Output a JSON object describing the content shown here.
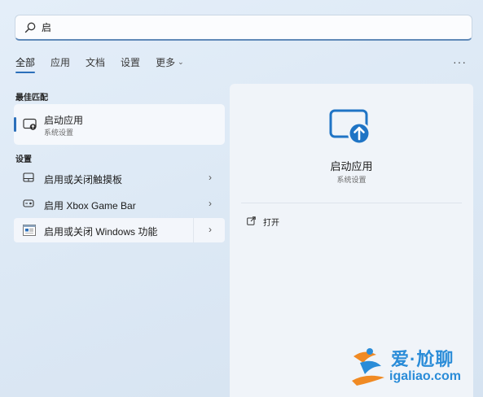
{
  "search": {
    "query": "启",
    "icon": "search-icon"
  },
  "tabs": [
    {
      "label": "全部",
      "active": true
    },
    {
      "label": "应用"
    },
    {
      "label": "文档"
    },
    {
      "label": "设置"
    },
    {
      "label": "更多"
    }
  ],
  "more_menu_icon": "ellipsis-icon",
  "best_match": {
    "header": "最佳匹配",
    "title": "启动应用",
    "subtitle": "系统设置",
    "icon": "startup-apps-icon"
  },
  "settings": {
    "header": "设置",
    "items": [
      {
        "label": "启用或关闭触摸板",
        "icon": "touchpad-icon",
        "selected": false
      },
      {
        "label": "启用 Xbox Game Bar",
        "icon": "game-bar-icon",
        "selected": false
      },
      {
        "label": "启用或关闭 Windows 功能",
        "icon": "windows-features-icon",
        "selected": true
      }
    ]
  },
  "detail": {
    "title": "启动应用",
    "subtitle": "系统设置",
    "actions": [
      {
        "label": "打开",
        "icon": "open-external-icon"
      }
    ]
  },
  "watermark": {
    "title": "爱·尬聊",
    "domain": "igaliao.com"
  },
  "colors": {
    "accent": "#2b6fba",
    "icon_blue": "#1f74c5",
    "watermark": "#2a8cd8",
    "watermark_orange": "#f08a24"
  }
}
